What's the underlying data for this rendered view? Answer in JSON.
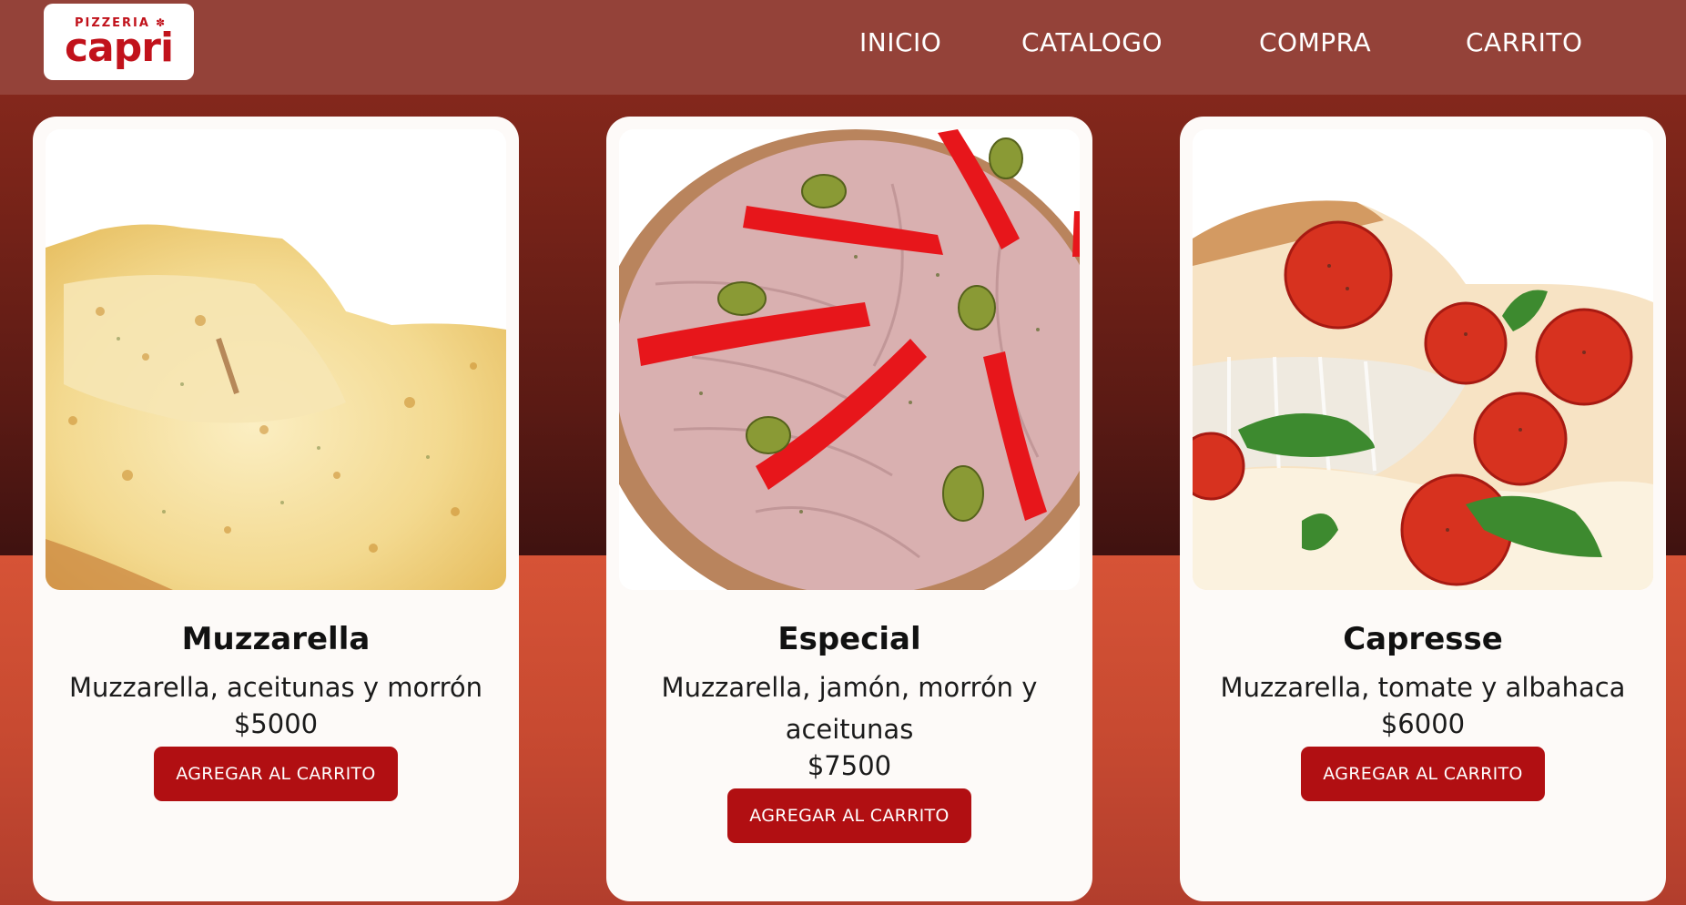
{
  "logo": {
    "top_text": "PIZZERIA",
    "main_text": "capri",
    "color": "#c1121b"
  },
  "nav": {
    "items": [
      {
        "label": "INICIO"
      },
      {
        "label": "CATALOGO"
      },
      {
        "label": "COMPRA"
      },
      {
        "label": "CARRITO"
      }
    ]
  },
  "colors": {
    "navbar": "#944239",
    "button": "#b10f12",
    "card": "#fdfaf8"
  },
  "products": [
    {
      "name": "Muzzarella",
      "description": "Muzzarella, aceitunas y morrón",
      "price": "$5000",
      "button_label": "AGREGAR AL CARRITO",
      "image": "cheese-pizza-image"
    },
    {
      "name": "Especial",
      "description": "Muzzarella, jamón, morrón y aceitunas",
      "price": "$7500",
      "button_label": "AGREGAR AL CARRITO",
      "image": "ham-pepper-olive-pizza-image"
    },
    {
      "name": "Capresse",
      "description": "Muzzarella, tomate y albahaca",
      "price": "$6000",
      "button_label": "AGREGAR AL CARRITO",
      "image": "tomato-basil-pizza-image"
    }
  ]
}
